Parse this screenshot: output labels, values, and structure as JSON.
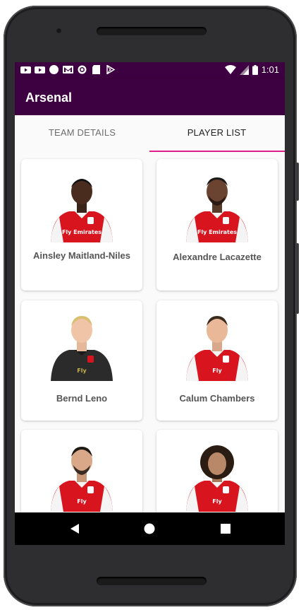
{
  "status_bar": {
    "time": "1:01",
    "left_icons": [
      "youtube-icon",
      "youtube-icon",
      "circle-icon",
      "gmail-icon",
      "record-icon",
      "sd-card-icon",
      "play-store-icon"
    ],
    "right_icons": [
      "wifi-icon",
      "signal-icon",
      "battery-icon"
    ]
  },
  "app_bar": {
    "title": "Arsenal"
  },
  "tabs": [
    {
      "label": "TEAM DETAILS",
      "selected": false
    },
    {
      "label": "PLAYER LIST",
      "selected": true
    }
  ],
  "players": [
    {
      "name": "Ainsley Maitland-Niles",
      "kit": "home"
    },
    {
      "name": "Alexandre Lacazette",
      "kit": "home"
    },
    {
      "name": "Bernd Leno",
      "kit": "goalkeeper"
    },
    {
      "name": "Calum Chambers",
      "kit": "home"
    },
    {
      "name": "",
      "kit": "home"
    },
    {
      "name": "",
      "kit": "home"
    }
  ],
  "nav_bar": {
    "buttons": [
      "back-icon",
      "home-icon",
      "recents-icon"
    ]
  },
  "colors": {
    "primary": "#3d0040",
    "accent": "#e0208a",
    "kit_red": "#d8141f",
    "gk_kit": "#2b2b2b"
  }
}
